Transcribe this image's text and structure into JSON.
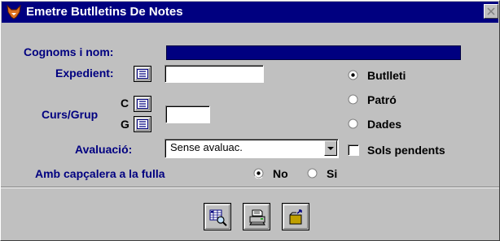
{
  "window": {
    "title": "Emetre Butlletins De Notes",
    "icon": "fox-app-icon",
    "title_bar_color": "#000080",
    "background_color": "#c0c0c0"
  },
  "form": {
    "cognoms_label": "Cognoms i nom:",
    "cognoms_value": "",
    "expedient_label": "Expedient:",
    "expedient_value": "",
    "curs_grup_label": "Curs/Grup",
    "curs_letter": "C",
    "grup_letter": "G",
    "curs_grup_value": "",
    "avaluacio_label": "Avaluació:",
    "avaluacio_selected": "Sense avaluac.",
    "capcalera_label": "Amb capçalera a la fulla",
    "capcalera_no": "No",
    "capcalera_si": "Si",
    "capcalera_selected": "No"
  },
  "output_options": {
    "items": [
      "Butlleti",
      "Patró",
      "Dades"
    ],
    "selected": "Butlleti",
    "sols_pendents_label": "Sols pendents",
    "sols_pendents_checked": false
  },
  "toolbar": {
    "buttons": [
      "preview-icon",
      "printer-icon",
      "exit-icon"
    ]
  }
}
